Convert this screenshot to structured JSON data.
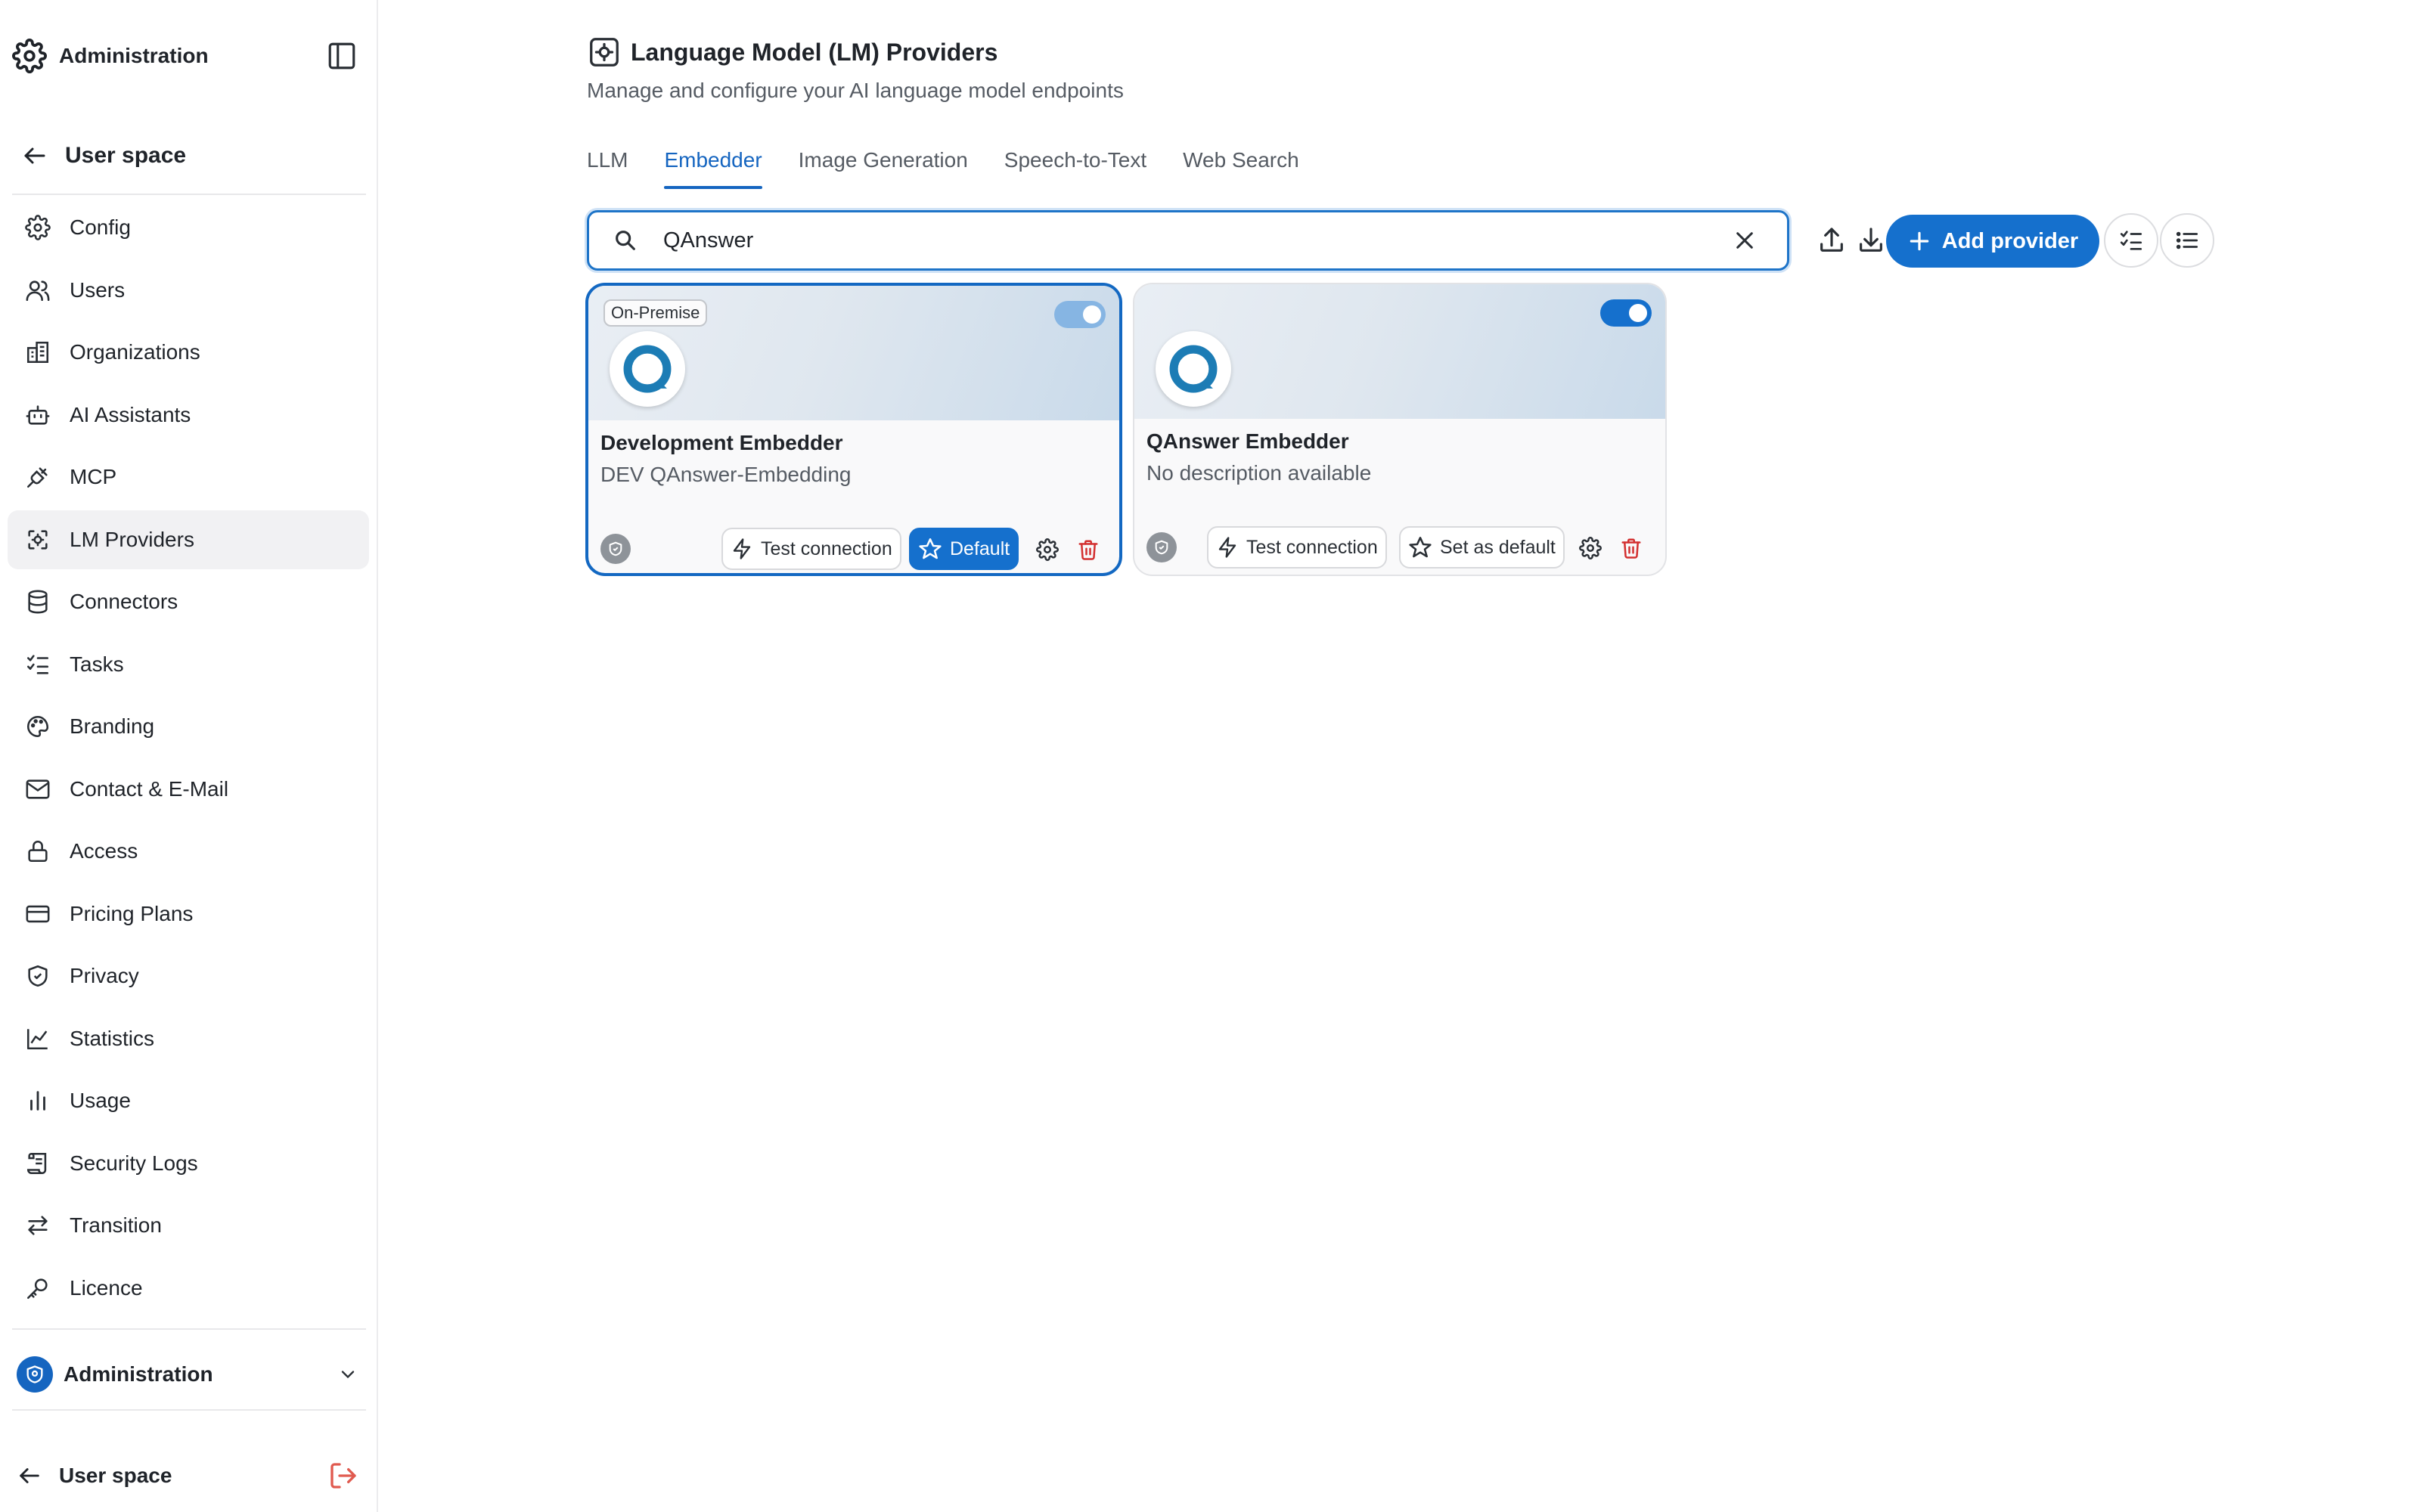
{
  "colors": {
    "accent": "#1570cd",
    "danger": "#d32f2f",
    "active_nav_bg": "#f1f1f3"
  },
  "sidebar": {
    "app_title": "Administration",
    "back_label": "User space",
    "items": [
      {
        "label": "Config",
        "icon": "gear-icon"
      },
      {
        "label": "Users",
        "icon": "users-icon"
      },
      {
        "label": "Organizations",
        "icon": "building-icon"
      },
      {
        "label": "AI Assistants",
        "icon": "robot-icon"
      },
      {
        "label": "MCP",
        "icon": "plug-icon"
      },
      {
        "label": "LM Providers",
        "icon": "chip-icon",
        "active": true
      },
      {
        "label": "Connectors",
        "icon": "database-icon"
      },
      {
        "label": "Tasks",
        "icon": "checklist-icon"
      },
      {
        "label": "Branding",
        "icon": "palette-icon"
      },
      {
        "label": "Contact & E-Mail",
        "icon": "mail-icon"
      },
      {
        "label": "Access",
        "icon": "lock-icon"
      },
      {
        "label": "Pricing Plans",
        "icon": "credit-card-icon"
      },
      {
        "label": "Privacy",
        "icon": "shield-check-icon"
      },
      {
        "label": "Statistics",
        "icon": "line-chart-icon"
      },
      {
        "label": "Usage",
        "icon": "bar-chart-icon"
      },
      {
        "label": "Security Logs",
        "icon": "scroll-icon"
      },
      {
        "label": "Transition",
        "icon": "arrows-icon"
      },
      {
        "label": "Licence",
        "icon": "key-icon"
      }
    ],
    "org_selector": {
      "label": "Administration"
    },
    "footer": {
      "label": "User space"
    }
  },
  "header": {
    "title": "Language Model (LM) Providers",
    "subtitle": "Manage and configure your AI language model endpoints"
  },
  "tabs": [
    {
      "label": "LLM",
      "active": false
    },
    {
      "label": "Embedder",
      "active": true
    },
    {
      "label": "Image Generation",
      "active": false
    },
    {
      "label": "Speech-to-Text",
      "active": false
    },
    {
      "label": "Web Search",
      "active": false
    }
  ],
  "search": {
    "value": "QAnswer",
    "placeholder": ""
  },
  "toolbar": {
    "add_label": "Add provider"
  },
  "cards": [
    {
      "name": "Development Embedder",
      "description": "DEV QAnswer-Embedding",
      "badge": "On-Premise",
      "enabled": true,
      "selected": true,
      "test_label": "Test connection",
      "default_label": "Default",
      "is_default": true
    },
    {
      "name": "QAnswer Embedder",
      "description": "No description available",
      "enabled": true,
      "selected": false,
      "test_label": "Test connection",
      "default_label": "Set as default",
      "is_default": false
    }
  ]
}
